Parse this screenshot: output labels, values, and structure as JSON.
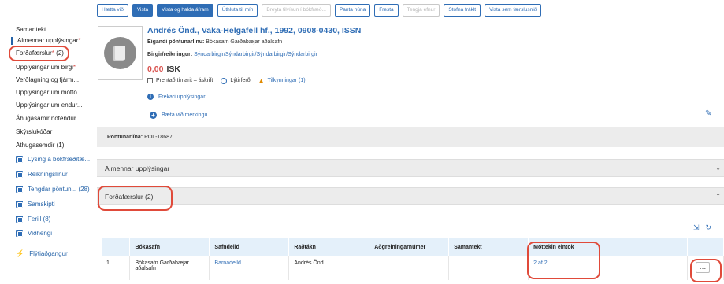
{
  "sidebar": {
    "items": [
      {
        "label": "Samantekt"
      },
      {
        "label": "Almennar upplýsingar",
        "req": "*"
      },
      {
        "label": "Forðafærslur",
        "req": "*",
        "count": "(2)"
      },
      {
        "label": "Upplýsingar um birgi",
        "req": "*"
      },
      {
        "label": "Verðlagning og fjárm..."
      },
      {
        "label": "Upplýsingar um móttö..."
      },
      {
        "label": "Upplýsingar um endur..."
      },
      {
        "label": "Áhugasamir notendur"
      },
      {
        "label": "Skýrslukóðar"
      },
      {
        "label": "Athugasemdir (1)"
      }
    ],
    "links": [
      {
        "label": "Lýsing á bókfræðitæ...",
        "icon": "record-icon"
      },
      {
        "label": "Reikningslínur",
        "icon": "record-icon"
      },
      {
        "label": "Tengdar pöntun... (28)",
        "icon": "record-icon"
      },
      {
        "label": "Samskipti",
        "icon": "record-icon"
      },
      {
        "label": "Ferill (8)",
        "icon": "record-icon"
      },
      {
        "label": "Viðhengi",
        "icon": "record-icon"
      },
      {
        "label": "Flýtiaðgangur",
        "icon": "bolt-icon"
      }
    ]
  },
  "toolbar": {
    "buttons": [
      {
        "label": "Hætta við",
        "style": "outline"
      },
      {
        "label": "Vista",
        "style": "primary"
      },
      {
        "label": "Vista og halda áfram",
        "style": "primary"
      },
      {
        "label": "Úthluta til mín",
        "style": "outline"
      },
      {
        "label": "Breyta tilvísun í bókfræð...",
        "style": "disabled"
      },
      {
        "label": "Panta núna",
        "style": "outline"
      },
      {
        "label": "Fresta",
        "style": "outline"
      },
      {
        "label": "Tengja efnur",
        "style": "disabled"
      },
      {
        "label": "Stofna fráklt",
        "style": "outline"
      },
      {
        "label": "Vista sem færslusnið",
        "style": "outline"
      }
    ]
  },
  "header": {
    "title": "Andrés Önd., Vaka-Helgafell hf., 1992, 0908-0430, ISSN",
    "owner_label": "Eigandi pöntunarlínu:",
    "owner_value": "Bókasafn Garðabæjar aðalsafn",
    "vendor_label": "Birgir/reikningur:",
    "vendor_value": "Sýndarbirgir/Sýndarbirgir/Sýndarbirgir/Sýndarbirgir",
    "price_amount": "0,00",
    "price_currency": "ISK",
    "flag_checkbox": "Prentað tímarit – áskrift",
    "flag_clock": "Lýtirferð",
    "flag_warning": "Tilkynningar (1)",
    "more_info": "Frekari upplýsingar",
    "add_tag": "Bæta við merkingu"
  },
  "order_line": {
    "label": "Pöntunarlína:",
    "value": "POL-18687"
  },
  "sections": {
    "general": "Almennar upplýsingar",
    "holdings": "Forðafærslur (2)"
  },
  "table": {
    "headers": [
      "",
      "Bókasafn",
      "Safndeild",
      "Raðtákn",
      "Aðgreiningarnúmer",
      "Samantekt",
      "Móttekin eintök",
      ""
    ],
    "rows": [
      {
        "num": "1",
        "library": "Bókasafn Garðabæjar aðalsafn",
        "location": "Barnadeild",
        "callnumber": "Andrés Önd",
        "barcode": "",
        "summary": "",
        "received": "2 af 2"
      }
    ]
  },
  "colors": {
    "accent": "#2f6db5",
    "highlight": "#e04a3a",
    "required": "#d9534f"
  }
}
